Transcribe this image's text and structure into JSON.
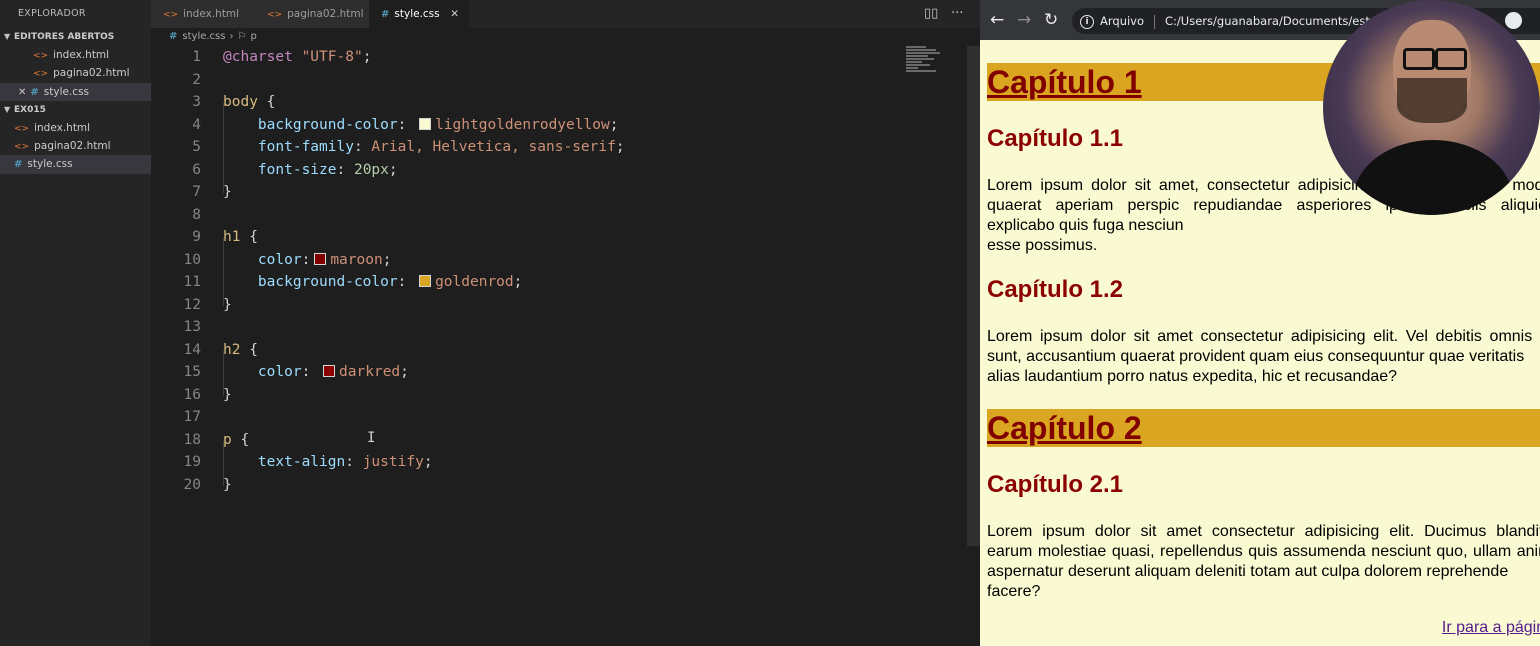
{
  "sidebar": {
    "title": "EXPLORADOR",
    "open_editors_label": "EDITORES ABERTOS",
    "open_editors": [
      "index.html",
      "pagina02.html",
      "style.css"
    ],
    "folder_label": "EX015",
    "files": [
      "index.html",
      "pagina02.html",
      "style.css"
    ]
  },
  "tabs": [
    {
      "label": "index.html",
      "icon": "html-file-icon"
    },
    {
      "label": "pagina02.html",
      "icon": "html-file-icon"
    },
    {
      "label": "style.css",
      "icon": "css-file-icon",
      "active": true
    }
  ],
  "breadcrumb": {
    "file": "style.css",
    "symbol": "p"
  },
  "editor": {
    "line_numbers": [
      "1",
      "2",
      "3",
      "4",
      "5",
      "6",
      "7",
      "8",
      "9",
      "10",
      "11",
      "12",
      "13",
      "14",
      "15",
      "16",
      "17",
      "18",
      "19",
      "20"
    ],
    "css": {
      "charset_kw": "@charset",
      "charset_val": "\"UTF-8\"",
      "body_sel": "body",
      "body_bg_prop": "background-color",
      "body_bg_val": "lightgoldenrodyellow",
      "body_ff_prop": "font-family",
      "body_ff_val": "Arial, Helvetica, sans-serif",
      "body_fs_prop": "font-size",
      "body_fs_val": "20px",
      "h1_sel": "h1",
      "h1_color_prop": "color",
      "h1_color_val": "maroon",
      "h1_bg_prop": "background-color",
      "h1_bg_val": "goldenrod",
      "h2_sel": "h2",
      "h2_color_prop": "color",
      "h2_color_val": "darkred",
      "p_sel": "p",
      "p_ta_prop": "text-align",
      "p_ta_val": "justify"
    },
    "swatches": {
      "lightgoldenrodyellow": "#fafad2",
      "maroon": "#800000",
      "goldenrod": "#daa520",
      "darkred": "#8b0000"
    }
  },
  "browser": {
    "address_scheme": "Arquivo",
    "address_url": "C:/Users/guanabara/Documents/estudo",
    "page": {
      "h1_a": "Capítulo 1",
      "h2_a": "Capítulo 1.1",
      "p_a": "Lorem ipsum dolor sit amet, consectetur adipisicin, itaque vitae optio modi quaerat aperiam perspic repudiandae asperiores ipsam officiis aliquid explicabo quis fuga nesciun",
      "p_a_last": "esse possimus.",
      "h2_b": "Capítulo 1.2",
      "p_b": "Lorem ipsum dolor sit amet consectetur adipisicing elit. Vel debitis omnis il sunt, accusantium quaerat provident quam eius consequuntur quae veritatis",
      "p_b_last": "alias laudantium porro natus expedita, hic et recusandae?",
      "h1_b": "Capítulo 2",
      "h2_c": "Capítulo 2.1",
      "p_c": "Lorem ipsum dolor sit amet consectetur adipisicing elit. Ducimus blanditi earum molestiae quasi, repellendus quis assumenda nesciunt quo, ullam anin aspernatur deserunt aliquam deleniti totam aut culpa dolorem reprehende",
      "p_c_last": "facere?",
      "link": "Ir para a página"
    }
  },
  "colors": {
    "maroon": "#800000",
    "darkred": "#8b0000",
    "goldenrod": "#daa520",
    "page_bg": "#fafad2"
  }
}
